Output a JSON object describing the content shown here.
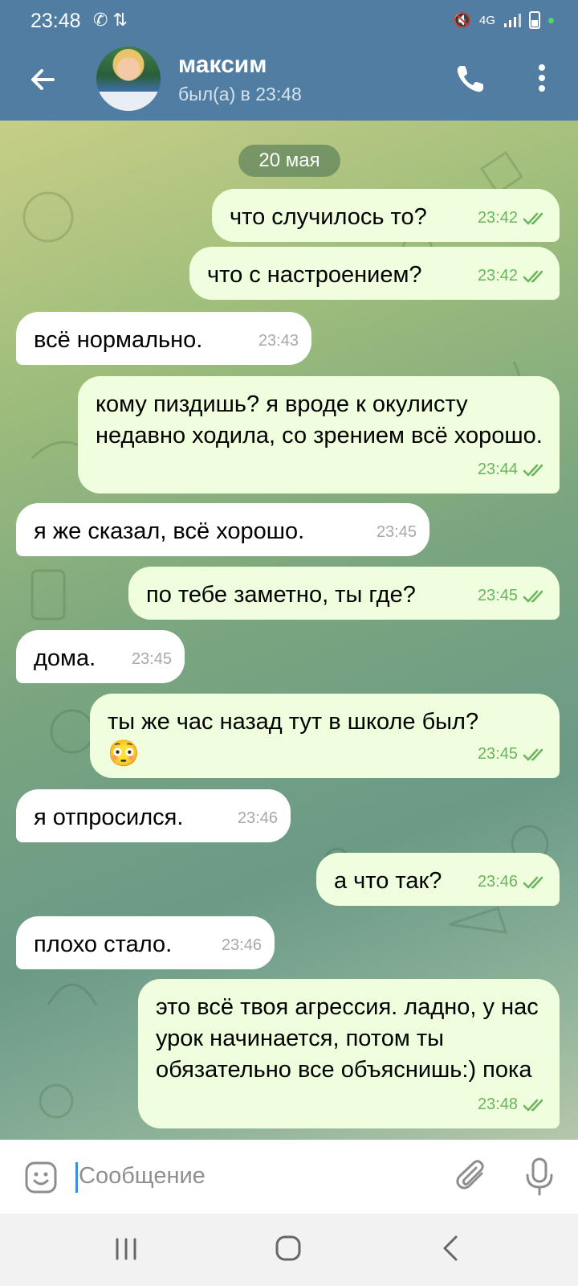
{
  "status_bar": {
    "time": "23:48",
    "network": "4G",
    "icons": [
      "phone-call-icon",
      "data-transfer-icon",
      "mute-icon",
      "signal-icon",
      "battery-icon"
    ]
  },
  "header": {
    "contact_name": "максим",
    "contact_status": "был(а) в 23:48",
    "back_icon": "arrow-left-icon",
    "call_icon": "phone-icon",
    "more_icon": "vertical-dots-icon"
  },
  "chat": {
    "date_chip": "20 мая",
    "messages": [
      {
        "dir": "out",
        "text": "что случилось то?",
        "time": "23:42",
        "read": true
      },
      {
        "dir": "out",
        "text": "что с настроением?",
        "time": "23:42",
        "read": true
      },
      {
        "dir": "in",
        "text": "всё нормально.",
        "time": "23:43"
      },
      {
        "dir": "out",
        "text": "кому пиздишь? я вроде к окулисту недавно ходила, со зрением всё хорошо.",
        "time": "23:44",
        "read": true
      },
      {
        "dir": "in",
        "text": "я же сказал, всё хорошо.",
        "time": "23:45"
      },
      {
        "dir": "out",
        "text": "по тебе заметно, ты где?",
        "time": "23:45",
        "read": true
      },
      {
        "dir": "in",
        "text": "дома.",
        "time": "23:45"
      },
      {
        "dir": "out",
        "text": "ты же час назад тут в школе был?",
        "emoji": "😳",
        "time": "23:45",
        "read": true
      },
      {
        "dir": "in",
        "text": "я отпросился.",
        "time": "23:46"
      },
      {
        "dir": "out",
        "text": "а что так?",
        "time": "23:46",
        "read": true
      },
      {
        "dir": "in",
        "text": "плохо стало.",
        "time": "23:46"
      },
      {
        "dir": "out",
        "text": "это всё твоя агрессия. ладно, у нас урок начинается, потом ты обязательно все объяснишь:) пока",
        "time": "23:48",
        "read": true
      }
    ]
  },
  "input_bar": {
    "placeholder": "Сообщение",
    "emoji_icon": "sticker-smile-icon",
    "attach_icon": "paperclip-icon",
    "mic_icon": "microphone-icon"
  },
  "nav_bar": {
    "icons": [
      "recents-icon",
      "home-icon",
      "back-chevron-icon"
    ]
  },
  "colors": {
    "header_bg": "#517DA2",
    "out_bubble": "#EFFEDD",
    "in_bubble": "#FFFFFF",
    "out_time": "#6BB35F",
    "in_time": "#A8A8A8"
  }
}
